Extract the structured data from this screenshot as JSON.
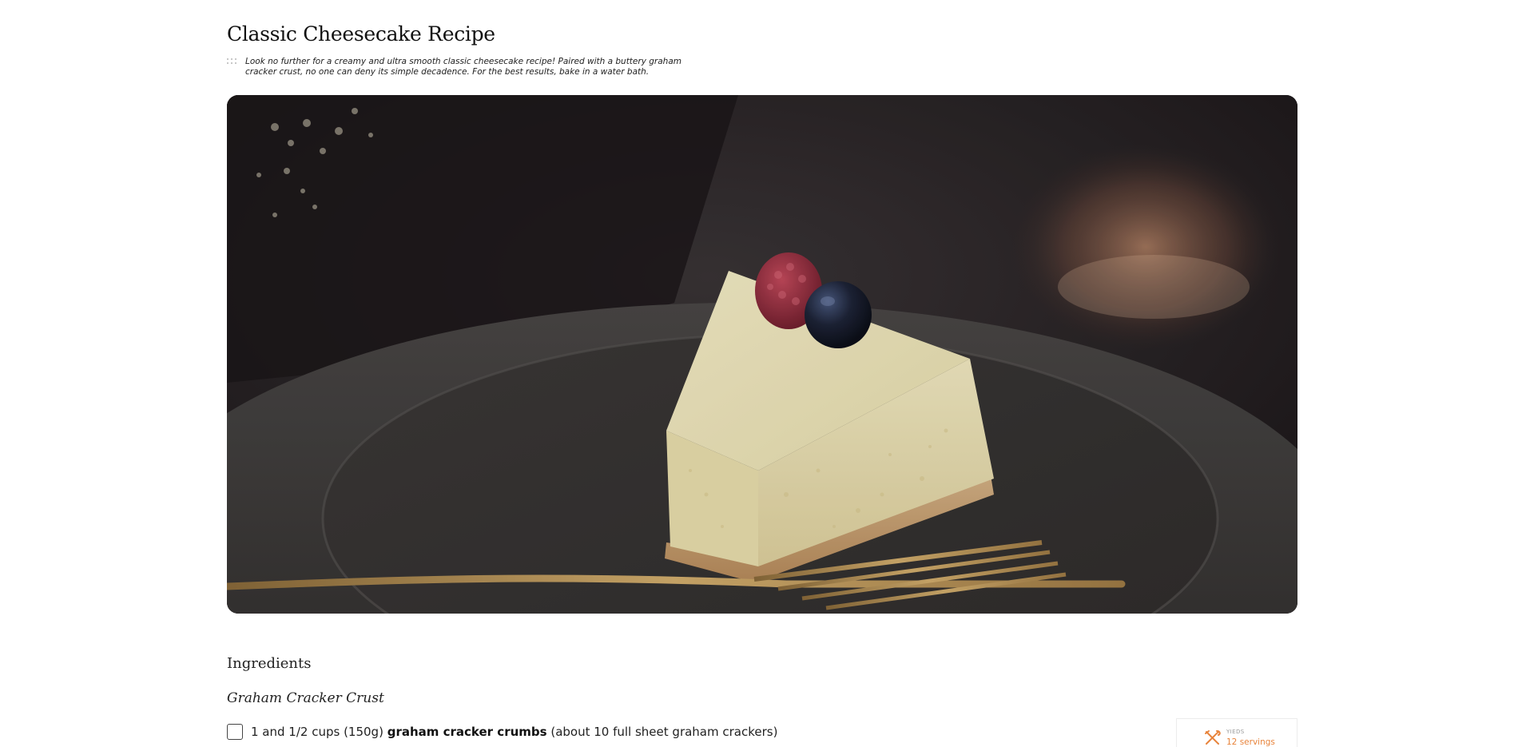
{
  "recipe": {
    "title": "Classic Cheesecake Recipe",
    "summary": "Look no further for a creamy and ultra smooth classic cheesecake recipe! Paired with a buttery graham cracker crust, no one can deny its simple decadence. For the best results, bake in a water bath.",
    "image": {
      "subject": "slice of cheesecake topped with a raspberry and a blueberry on a dark plate with a gold fork"
    }
  },
  "ingredients": {
    "heading": "Ingredients",
    "group_title": "Graham Cracker Crust",
    "items": [
      {
        "checked": false,
        "amount": "1 and 1/2 cups (150g)",
        "name": "graham cracker crumbs",
        "notes": "(about 10 full sheet graham crackers)"
      }
    ]
  },
  "yields": {
    "label": "YIEDS",
    "value": "12 servings",
    "icon": "utensils-icon",
    "accent_color": "#e8843c"
  },
  "colors": {
    "text": "#111111",
    "accent": "#e8843c",
    "background": "#ffffff"
  }
}
